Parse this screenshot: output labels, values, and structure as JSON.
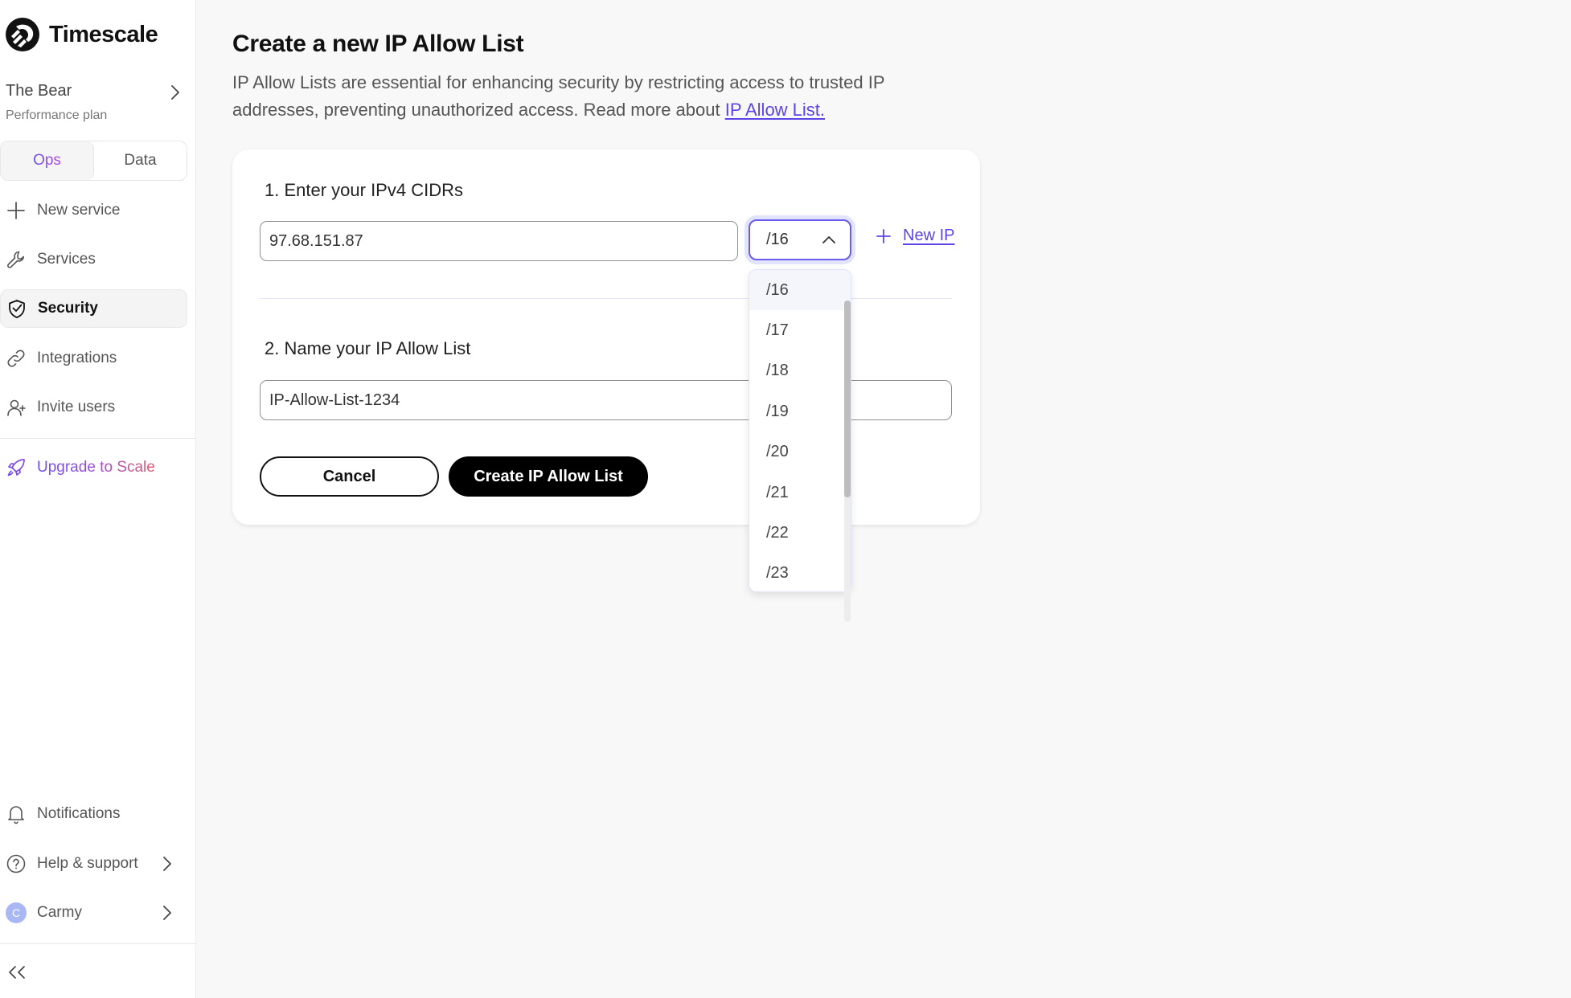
{
  "app": {
    "brand": "Timescale",
    "project": {
      "name": "The Bear",
      "plan": "Performance plan"
    },
    "mode_tabs": [
      {
        "label": "Ops",
        "active": true
      },
      {
        "label": "Data",
        "active": false
      }
    ]
  },
  "sidebar": {
    "items": [
      {
        "label": "New service",
        "icon": "plus-icon"
      },
      {
        "label": "Services",
        "icon": "wrench-icon"
      },
      {
        "label": "Security",
        "icon": "shield-check-icon",
        "active": true
      },
      {
        "label": "Integrations",
        "icon": "link-icon"
      },
      {
        "label": "Invite users",
        "icon": "user-plus-icon"
      }
    ],
    "upgrade": {
      "label": "Upgrade to Scale",
      "icon": "rocket-icon"
    },
    "bottom": [
      {
        "label": "Notifications",
        "icon": "bell-icon"
      },
      {
        "label": "Help & support",
        "icon": "help-circle-icon"
      },
      {
        "label": "Carmy",
        "avatar_initial": "C"
      }
    ],
    "collapse_icon": "chevrons-left-icon"
  },
  "page": {
    "title": "Create a new IP Allow List",
    "description": "IP Allow Lists are essential for enhancing security by restricting access to trusted IP addresses, preventing unauthorized access. Read more about ",
    "description_link": "IP Allow List."
  },
  "form": {
    "step1_label": "1. Enter your IPv4 CIDRs",
    "ip_value": "97.68.151.87",
    "cidr_selected": "/16",
    "cidr_open": true,
    "cidr_options": [
      "/16",
      "/17",
      "/18",
      "/19",
      "/20",
      "/21",
      "/22",
      "/23"
    ],
    "new_ip_label": "New IP",
    "step2_label": "2. Name your IP Allow List",
    "name_value": "IP-Allow-List-1234",
    "cancel_label": "Cancel",
    "create_label": "Create IP Allow List"
  },
  "colors": {
    "accent": "#5b45e8",
    "focus_ring": "#e1e4fb",
    "upgrade_gradient": [
      "#6a4cf2",
      "#e8576a"
    ],
    "avatar": "#a9b8f5"
  }
}
